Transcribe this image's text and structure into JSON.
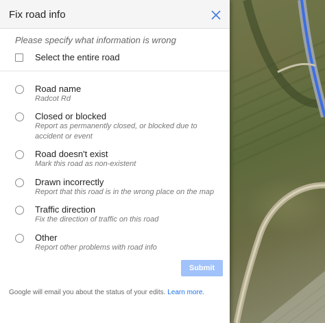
{
  "dialog": {
    "title": "Fix road info",
    "close_icon": "close-icon",
    "prompt": "Please specify what information is wrong",
    "select_entire_road_label": "Select the entire road",
    "select_entire_road_checked": false,
    "options": [
      {
        "label": "Road name",
        "description": "Radcot Rd",
        "selected": false
      },
      {
        "label": "Closed or blocked",
        "description": "Report as permanently closed, or blocked due to accident or event",
        "selected": false
      },
      {
        "label": "Road doesn't exist",
        "description": "Mark this road as non-existent",
        "selected": false
      },
      {
        "label": "Drawn incorrectly",
        "description": "Report that this road is in the wrong place on the map",
        "selected": false
      },
      {
        "label": "Traffic direction",
        "description": "Fix the direction of traffic on this road",
        "selected": false
      },
      {
        "label": "Other",
        "description": "Report other problems with road info",
        "selected": false
      }
    ],
    "submit_label": "Submit",
    "submit_enabled": false,
    "footer_text": "Google will email you about the status of your edits.",
    "footer_link": "Learn more."
  },
  "colors": {
    "submit_disabled": "#a1c2fa",
    "link": "#1a73e8",
    "header_bg": "#f5f5f5",
    "close_icon": "#4a7fdc"
  }
}
